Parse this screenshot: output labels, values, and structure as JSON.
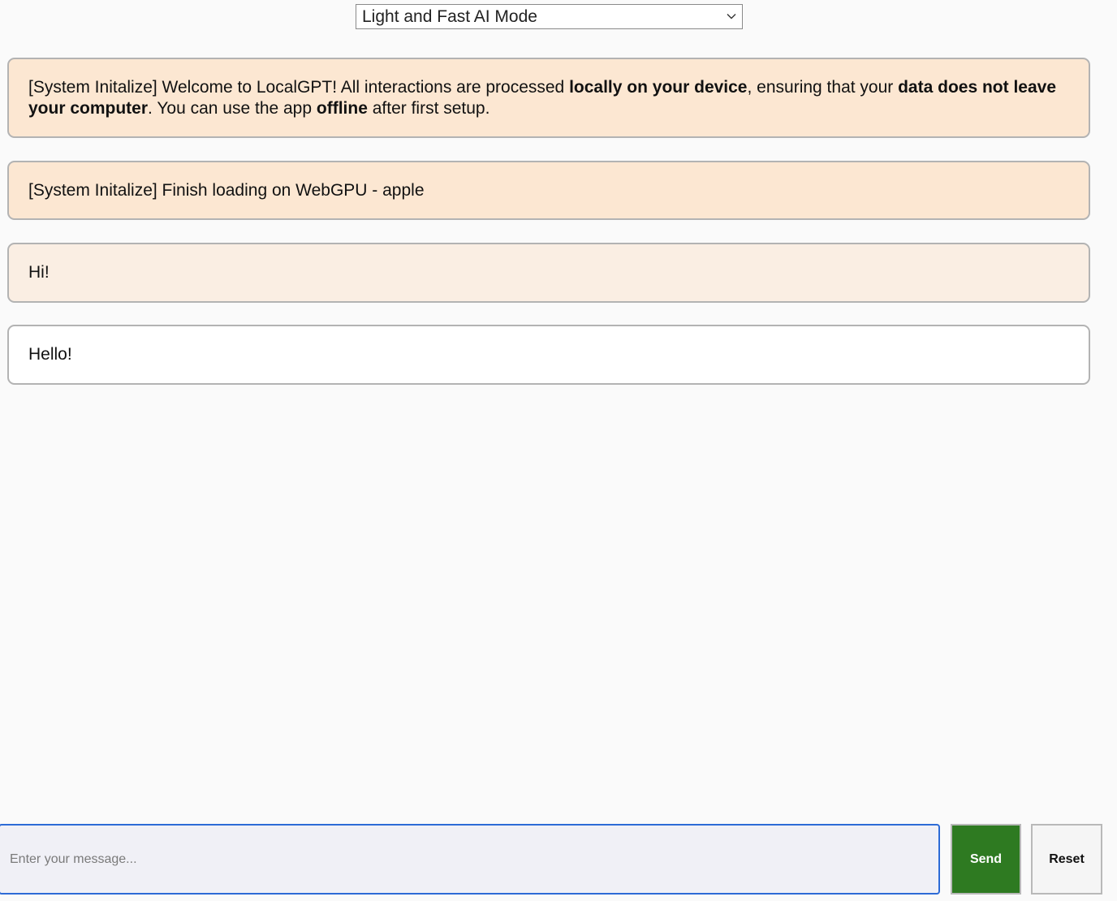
{
  "header": {
    "mode_selected": "Light and Fast AI Mode"
  },
  "messages": [
    {
      "role": "system",
      "segments": [
        {
          "text": "[System Initalize] Welcome to LocalGPT! All interactions are processed ",
          "bold": false
        },
        {
          "text": "locally on your device",
          "bold": true
        },
        {
          "text": ", ensuring that your ",
          "bold": false
        },
        {
          "text": "data does not leave your computer",
          "bold": true
        },
        {
          "text": ". You can use the app ",
          "bold": false
        },
        {
          "text": "offline",
          "bold": true
        },
        {
          "text": " after first setup.",
          "bold": false
        }
      ]
    },
    {
      "role": "system",
      "text": "[System Initalize] Finish loading on WebGPU - apple"
    },
    {
      "role": "user",
      "text": "Hi!"
    },
    {
      "role": "assistant",
      "text": "Hello!"
    }
  ],
  "composer": {
    "placeholder": "Enter your message...",
    "value": "",
    "send_label": "Send",
    "reset_label": "Reset"
  },
  "colors": {
    "system_bg": "#fce7d2",
    "user_bg": "#faeee3",
    "assistant_bg": "#ffffff",
    "send_bg": "#2e7a21",
    "input_border": "#2d6bd6"
  },
  "icons": {
    "mode_select_indicator": "chevron-down-icon"
  }
}
